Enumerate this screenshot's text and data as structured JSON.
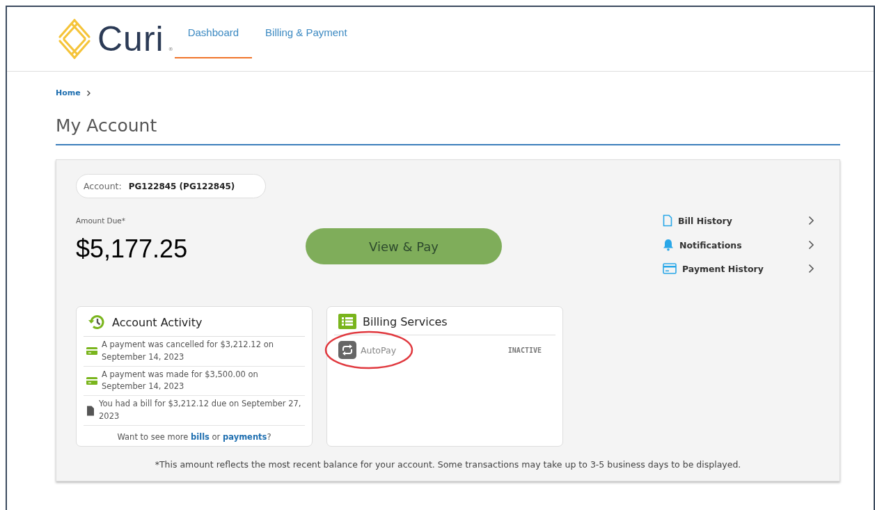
{
  "header": {
    "logo": {
      "text": "Curi",
      "mark": "®"
    },
    "nav": [
      {
        "label": "Dashboard",
        "selected": true
      },
      {
        "label": "Billing & Payment",
        "selected": false
      }
    ]
  },
  "breadcrumb": [
    "Home"
  ],
  "page_title": "My Account",
  "account": {
    "label": "Account:",
    "value": "PG122845 (PG122845)"
  },
  "amount_due": {
    "label": "Amount Due*",
    "value": "$5,177.25"
  },
  "pay_button": "View & Pay",
  "quick_links": [
    {
      "kind": "document",
      "label": "Bill History"
    },
    {
      "kind": "bell",
      "label": "Notifications"
    },
    {
      "kind": "card",
      "label": "Payment History"
    }
  ],
  "activity": {
    "title": "Account Activity",
    "items": [
      {
        "kind": "payment",
        "text": "A payment was cancelled for $3,212.12 on September 14, 2023"
      },
      {
        "kind": "payment",
        "text": "A payment was made for $3,500.00 on September 14, 2023"
      },
      {
        "kind": "bill",
        "text": "You had a bill for $3,212.12 due on September 27, 2023"
      }
    ],
    "more": {
      "start": "Want to see more",
      "links": [
        "bills",
        "payments"
      ],
      "joiner": "or",
      "end": "?"
    }
  },
  "services": {
    "title": "Billing Services",
    "items": [
      {
        "name": "AutoPay",
        "status": "INACTIVE",
        "active": false,
        "highlighted": true
      }
    ]
  },
  "footnote": "*This amount reflects the most recent balance for your account. Some transactions may take up to 3-5 business days to be displayed."
}
